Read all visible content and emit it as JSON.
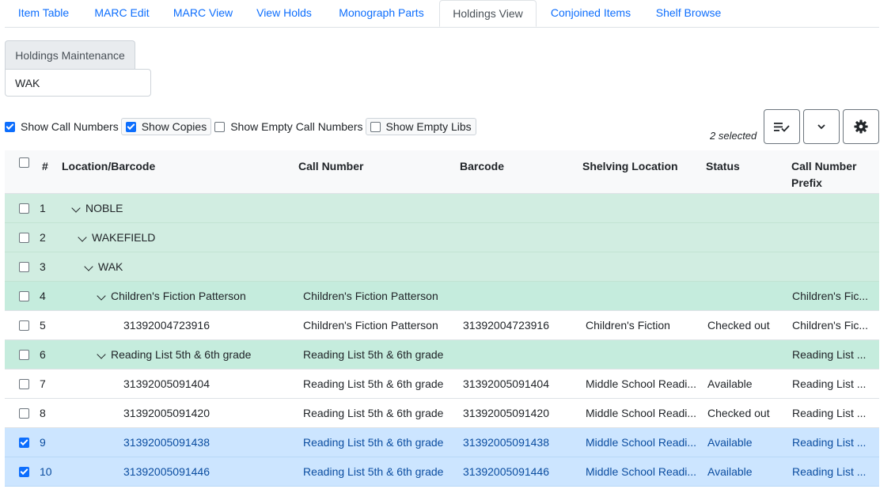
{
  "tabs": [
    {
      "label": "Item Table",
      "active": false
    },
    {
      "label": "MARC Edit",
      "active": false
    },
    {
      "label": "MARC View",
      "active": false
    },
    {
      "label": "View Holds",
      "active": false
    },
    {
      "label": "Monograph Parts",
      "active": false
    },
    {
      "label": "Holdings View",
      "active": true
    },
    {
      "label": "Conjoined Items",
      "active": false
    },
    {
      "label": "Shelf Browse",
      "active": false
    }
  ],
  "holdings_button": "Holdings Maintenance",
  "library_input": {
    "value": "WAK"
  },
  "options": [
    {
      "label": "Show Call Numbers",
      "checked": true
    },
    {
      "label": "Show Copies",
      "checked": true
    },
    {
      "label": "Show Empty Call Numbers",
      "checked": false
    },
    {
      "label": "Show Empty Libs",
      "checked": false
    }
  ],
  "selected_count": "2 selected",
  "toolbar_icons": [
    "column-sort-icon",
    "chevron-down-icon",
    "gear-icon"
  ],
  "columns": {
    "num": "#",
    "location": "Location/Barcode",
    "callnumber": "Call Number",
    "barcode": "Barcode",
    "shelving": "Shelving Location",
    "status": "Status",
    "prefix": "Call Number Prefix"
  },
  "rows": [
    {
      "num": "1",
      "location": "NOBLE",
      "callnumber": "",
      "barcode": "",
      "shelving": "",
      "status": "",
      "prefix": "",
      "type": "org",
      "checked": false
    },
    {
      "num": "2",
      "location": "WAKEFIELD",
      "callnumber": "",
      "barcode": "",
      "shelving": "",
      "status": "",
      "prefix": "",
      "type": "org",
      "checked": false
    },
    {
      "num": "3",
      "location": "WAK",
      "callnumber": "",
      "barcode": "",
      "shelving": "",
      "status": "",
      "prefix": "",
      "type": "org",
      "checked": false
    },
    {
      "num": "4",
      "location": "Children's Fiction Patterson",
      "callnumber": "Children's Fiction Patterson",
      "barcode": "",
      "shelving": "",
      "status": "",
      "prefix": "Children's Fic...",
      "type": "loc",
      "checked": false
    },
    {
      "num": "5",
      "location": "31392004723916",
      "callnumber": "Children's Fiction Patterson",
      "barcode": "31392004723916",
      "shelving": "Children's Fiction",
      "status": "Checked out",
      "prefix": "Children's Fic...",
      "type": "copy",
      "checked": false
    },
    {
      "num": "6",
      "location": "Reading List 5th & 6th grade",
      "callnumber": "Reading List 5th & 6th grade",
      "barcode": "",
      "shelving": "",
      "status": "",
      "prefix": "Reading List ...",
      "type": "loc",
      "checked": false
    },
    {
      "num": "7",
      "location": "31392005091404",
      "callnumber": "Reading List 5th & 6th grade",
      "barcode": "31392005091404",
      "shelving": "Middle School Readi...",
      "status": "Available",
      "prefix": "Reading List ...",
      "type": "copy",
      "checked": false
    },
    {
      "num": "8",
      "location": "31392005091420",
      "callnumber": "Reading List 5th & 6th grade",
      "barcode": "31392005091420",
      "shelving": "Middle School Readi...",
      "status": "Checked out",
      "prefix": "Reading List ...",
      "type": "copy",
      "checked": false
    },
    {
      "num": "9",
      "location": "31392005091438",
      "callnumber": "Reading List 5th & 6th grade",
      "barcode": "31392005091438",
      "shelving": "Middle School Readi...",
      "status": "Available",
      "prefix": "Reading List ...",
      "type": "copy",
      "checked": true
    },
    {
      "num": "10",
      "location": "31392005091446",
      "callnumber": "Reading List 5th & 6th grade",
      "barcode": "31392005091446",
      "shelving": "Middle School Readi...",
      "status": "Available",
      "prefix": "Reading List ...",
      "type": "copy",
      "checked": true
    }
  ]
}
